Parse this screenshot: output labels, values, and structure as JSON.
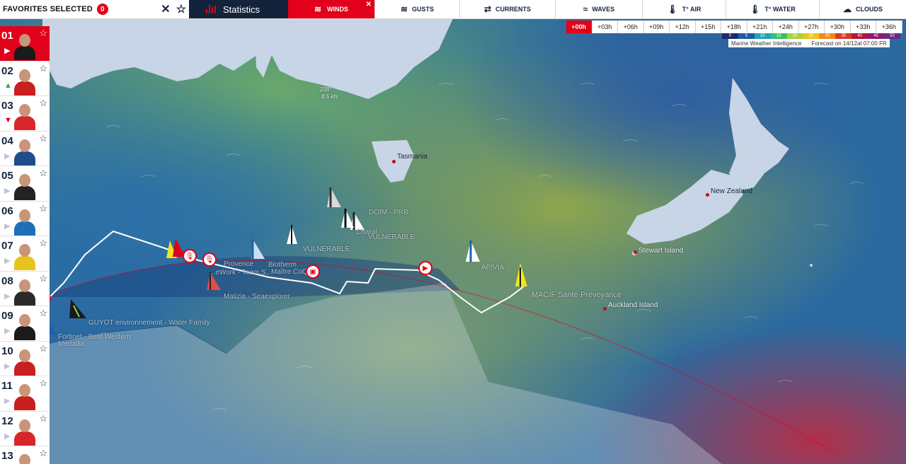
{
  "topbar": {
    "favorites_label": "FAVORITES SELECTED",
    "favorites_count": "0",
    "clear_icon": "close-icon",
    "star_icon": "star-icon",
    "statistics_label": "Statistics",
    "winds_label": "WINDS",
    "winds_close": "✕",
    "tabs": [
      {
        "label": "GUSTS",
        "icon": "gusts-icon",
        "glyph": "≋"
      },
      {
        "label": "CURRENTS",
        "icon": "currents-icon",
        "glyph": "⇄"
      },
      {
        "label": "WAVES",
        "icon": "waves-icon",
        "glyph": "≈"
      },
      {
        "label": "T° AIR",
        "icon": "thermometer-icon",
        "glyph": "🌡"
      },
      {
        "label": "T° WATER",
        "icon": "water-temp-icon",
        "glyph": "🌡"
      },
      {
        "label": "CLOUDS",
        "icon": "cloud-icon",
        "glyph": "☁"
      }
    ]
  },
  "timebar": {
    "steps": [
      "+00h",
      "+03h",
      "+06h",
      "+09h",
      "+12h",
      "+15h",
      "+18h",
      "+21h",
      "+24h",
      "+27h",
      "+30h",
      "+33h",
      "+36h"
    ],
    "active": "+00h"
  },
  "scale": {
    "labels": [
      "0",
      "5",
      "10",
      "15",
      "20",
      "25",
      "30",
      "35",
      "40",
      "45",
      "50"
    ],
    "colors": [
      "#1b2a6b",
      "#1f5aa6",
      "#1fa3b8",
      "#3cbf6a",
      "#a8d23a",
      "#f0c419",
      "#f08a1a",
      "#d83a1e",
      "#b0173a",
      "#8a1a6e",
      "#6b2a8a"
    ]
  },
  "forecast": {
    "source": "Marine Weather Intelligence",
    "time": "Forecast on 14/12at 07:00 FR"
  },
  "wind_readout": {
    "direction": "239°",
    "speed": "8.5 kts"
  },
  "ranks": [
    {
      "num": "01",
      "trend": "none",
      "suit": "#1a1a1a"
    },
    {
      "num": "02",
      "trend": "up",
      "suit": "#c8201e"
    },
    {
      "num": "03",
      "trend": "down",
      "suit": "#d9262b"
    },
    {
      "num": "04",
      "trend": "none",
      "suit": "#1e4d8c"
    },
    {
      "num": "05",
      "trend": "none",
      "suit": "#222"
    },
    {
      "num": "06",
      "trend": "none",
      "suit": "#1f6fb8"
    },
    {
      "num": "07",
      "trend": "none",
      "suit": "#e6c41c"
    },
    {
      "num": "08",
      "trend": "none",
      "suit": "#2a2a2a"
    },
    {
      "num": "09",
      "trend": "none",
      "suit": "#1a1a1a"
    },
    {
      "num": "10",
      "trend": "none",
      "suit": "#c8201e"
    },
    {
      "num": "11",
      "trend": "none",
      "suit": "#c8201e"
    },
    {
      "num": "12",
      "trend": "none",
      "suit": "#d9262b"
    },
    {
      "num": "13",
      "trend": "none",
      "suit": "#2a2a2a"
    }
  ],
  "places": {
    "tasmania": "Tasmania",
    "new_zealand": "New Zealand",
    "stewart": "Stewart Island",
    "auckland": "Auckland Island"
  },
  "boats": {
    "charal": "Charal",
    "doid_prb": "DOIM - PRB",
    "vulnerable1": "VULNERABLE",
    "vulnerable2": "VULNERABLE",
    "biotherm": "Biotherm",
    "maitre_coq": "Maître CoQ",
    "provence": "Provence",
    "teamwork": "...eWork - Team S...",
    "malizia": "Malizia - Seaexplorer",
    "guyot": "GUYOT environnement - Water Family",
    "fortinet": "Fortinet - Best Western",
    "medallia": "Medallia",
    "apivia": "APIVIA",
    "macif": "MACIF Santé Prévoyance"
  }
}
